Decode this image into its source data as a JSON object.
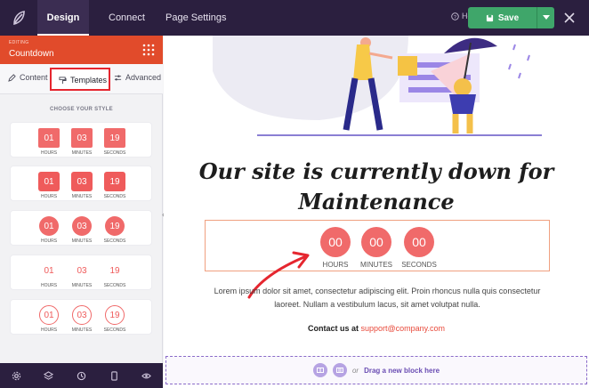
{
  "topbar": {
    "tabs": [
      "Design",
      "Connect",
      "Page Settings"
    ],
    "help_label": "Help",
    "save_label": "Save"
  },
  "sidebar": {
    "editing_label": "EDITING",
    "editing_title": "Countdown",
    "tabs": [
      "Content",
      "Templates",
      "Advanced"
    ],
    "choose_label": "CHOOSE YOUR STYLE",
    "templates": [
      {
        "values": [
          "01",
          "03",
          "19"
        ],
        "labels": [
          "HOURS",
          "MINUTES",
          "SECONDS"
        ]
      },
      {
        "values": [
          "01",
          "03",
          "19"
        ],
        "labels": [
          "HOURS",
          "MINUTES",
          "SECONDS"
        ]
      },
      {
        "values": [
          "01",
          "03",
          "19"
        ],
        "labels": [
          "HOURS",
          "MINUTES",
          "SECONDS"
        ]
      },
      {
        "values": [
          "01",
          "03",
          "19"
        ],
        "labels": [
          "HOURS",
          "MINUTES",
          "SECONDS"
        ]
      },
      {
        "values": [
          "01",
          "03",
          "19"
        ],
        "labels": [
          "HOURS",
          "MINUTES",
          "SECONDS"
        ]
      }
    ]
  },
  "canvas": {
    "headline_line1": "Our site is currently down for",
    "headline_line2": "Maintenance",
    "countdown": {
      "values": [
        "00",
        "00",
        "00"
      ],
      "labels": [
        "HOURS",
        "MINUTES",
        "SECONDS"
      ]
    },
    "body_line1": "Lorem ipsum dolor sit amet, consectetur adipiscing elit. Proin rhoncus nulla quis consectetur",
    "body_line2": "laoreet. Nullam a vestibulum lacus, sit amet volutpat nulla.",
    "contact_prefix": "Contact us at",
    "contact_email": "support@company.com",
    "dropzone_or": "or",
    "dropzone_label": "Drag a new block here"
  },
  "colors": {
    "topbar": "#2b1f3f",
    "accent_orange": "#e14b2b",
    "countdown_red": "#f06a6a",
    "save_green": "#3fa66a",
    "highlight_red": "#e5262f"
  }
}
